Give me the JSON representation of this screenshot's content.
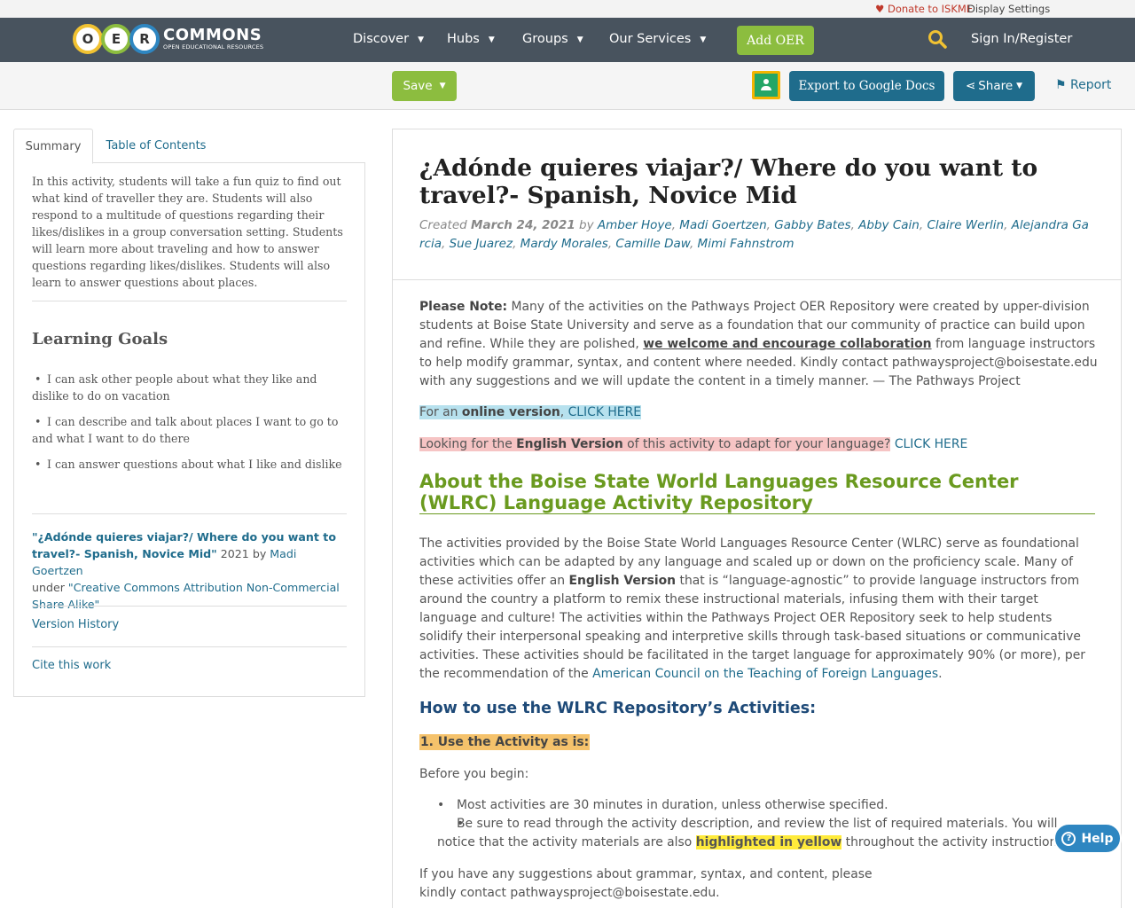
{
  "utility": {
    "donate_icon": "heart-icon",
    "donate": "Donate to ISKME",
    "display_settings": "Display Settings"
  },
  "nav": {
    "logo_letters": [
      "O",
      "E",
      "R"
    ],
    "logo_word": "COMMONS",
    "logo_sub": "OPEN EDUCATIONAL RESOURCES",
    "items": [
      "Discover",
      "Hubs",
      "Groups",
      "Our Services"
    ],
    "add_oer": "Add OER",
    "sign_in": "Sign In/Register"
  },
  "toolbar": {
    "save": "Save",
    "export": "Export to Google Docs",
    "share": "Share",
    "report": "Report"
  },
  "sidebar": {
    "tabs": [
      "Summary",
      "Table of Contents"
    ],
    "summary": "In this activity, students will take a fun quiz to find out what kind of traveller they are. Students will also respond to a multitude of questions regarding their likes/dislikes in a group conversation setting. Students will learn more about traveling and how to answer questions regarding likes/dislikes. Students will also learn to answer questions about places.",
    "goals_title": "Learning Goals",
    "goals": [
      "I can ask other people about what they like and dislike to do on vacation",
      "I can describe and talk about places I want to go to and what I want to do there",
      "I can answer questions about what I like and dislike"
    ],
    "attribution": {
      "title": "\"¿Adónde quieres viajar?/ Where do you want to travel?- Spanish, Novice Mid\"",
      "year_by": "2021 by",
      "author": "Madi Goertzen",
      "under": "under",
      "license": "\"Creative Commons Attribution Non-Commercial Share Alike\""
    },
    "version_history": "Version History",
    "cite": "Cite this work"
  },
  "main": {
    "title": "¿Adónde quieres viajar?/ Where do you want to travel?- Spanish, Novice Mid",
    "created_label": "Created",
    "created_date": "March 24, 2021",
    "by": "by",
    "authors": [
      "Amber Hoye",
      "Madi Goertzen",
      "Gabby Bates",
      "Abby Cain",
      "Claire Werlin",
      "Alejandra Garcia",
      "Sue Juarez",
      "Mardy Morales",
      "Camille Daw",
      "Mimi Fahnstrom"
    ],
    "note_label": "Please Note:",
    "note_1": "Many of the activities on the Pathways Project OER Repository were created by upper-division students at Boise State University and serve as a foundation that our community of practice can build upon and refine. While they are polished,",
    "note_link": "we welcome and encourage collaboration",
    "note_2": "from language instructors to help modify grammar, syntax, and content where needed. Kindly contact pathwaysproject@boisestate.edu with any suggestions and we will update the content in a timely manner.  — The Pathways Project",
    "online_pre": "For an",
    "online_bold": "online version",
    "online_link": "CLICK HERE",
    "english_pre": "Looking for the",
    "english_bold": "English Version",
    "english_post": "of this activity to adapt for your language?",
    "english_link": "CLICK HERE",
    "about_heading": "About the Boise State World Languages Resource Center (WLRC) Language Activity Repository",
    "about_1": "The activities provided by the Boise State World Languages Resource Center (WLRC) serve as foundational activities which can be adapted by any language and scaled up or down on the proficiency scale. Many of these activities offer an",
    "about_bold": "English Version",
    "about_2": "that is “language-agnostic” to provide language instructors from around the country a platform to remix these instructional materials, infusing them with their target language and culture! The activities within the Pathways Project OER Repository seek to help students solidify their interpersonal speaking and interpretive skills through task-based situations or communicative activities. These activities should be facilitated in the target language for approximately 90% (or more), per the recommendation of the",
    "about_link": "American Council on the Teaching of Foreign Languages",
    "about_end": ".",
    "howto_heading": "How to use the WLRC Repository’s Activities:",
    "use_as_is": "1. Use the Activity as is:",
    "before": "Before you begin:",
    "bullet_1": "Most activities are 30 minutes in duration, unless otherwise specified.",
    "bullet_2_pre": "Be sure to read through the activity description, and review the list of required materials. You will notice that the activity materials are also",
    "bullet_2_hl": "highlighted in yellow",
    "bullet_2_post": "throughout the activity instructions.",
    "suggest": "If you have any suggestions about grammar, syntax, and content, please kindly contact pathwaysproject@boisestate.edu."
  },
  "help": "Help",
  "colors": {
    "nav_bg": "#48535e",
    "green": "#8cbd3f",
    "teal": "#1f6c8c",
    "heading_green": "#6a9a1f"
  }
}
